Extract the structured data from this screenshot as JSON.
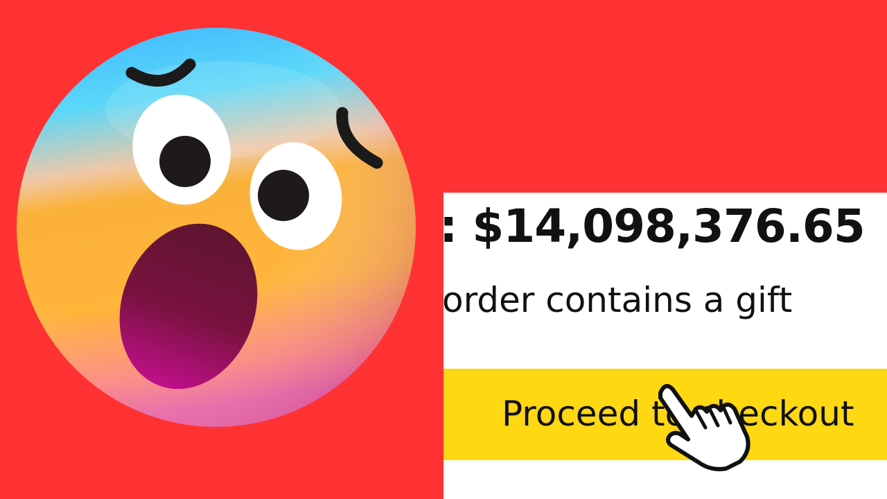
{
  "cart": {
    "subtotal_text": ": $14,098,376.65",
    "gift_text": "order contains a gift",
    "checkout_label": "Proceed to checkout"
  },
  "colors": {
    "background": "#ff3233",
    "button": "#ffd814",
    "panel": "#ffffff"
  },
  "icons": {
    "emoji": "fearful-face-emoji",
    "cursor": "hand-pointer-icon"
  }
}
